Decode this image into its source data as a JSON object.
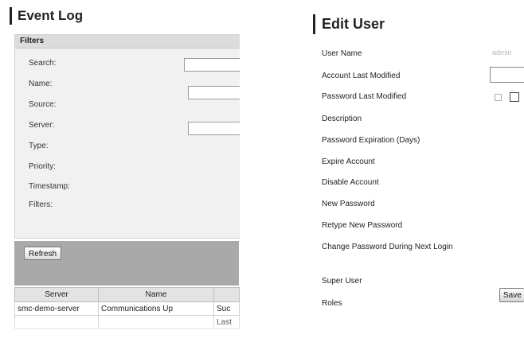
{
  "event_log": {
    "title": "Event Log",
    "filters_header": "Filters",
    "filters": [
      {
        "label": "Search:"
      },
      {
        "label": "Name:"
      },
      {
        "label": "Source:"
      },
      {
        "label": "Server:"
      },
      {
        "label": "Type:"
      },
      {
        "label": "Priority:"
      },
      {
        "label": "Timestamp:"
      },
      {
        "label": "Filters:"
      }
    ],
    "refresh_label": "Refresh",
    "table": {
      "columns": [
        "Server",
        "Name",
        ""
      ],
      "rows": [
        [
          "smc-demo-server",
          "Communications Up",
          "Suc"
        ],
        [
          "",
          "",
          "Last"
        ]
      ]
    }
  },
  "edit_user": {
    "title": "Edit User",
    "fields": {
      "user_name": "User Name",
      "account_last_modified": "Account Last Modified",
      "password_last_modified": "Password Last Modified",
      "description": "Description",
      "password_expiration": "Password Expiration (Days)",
      "expire_account": "Expire Account",
      "disable_account": "Disable Account",
      "new_password": "New Password",
      "retype_new_password": "Retype New Password",
      "change_password_next_login": "Change Password During Next Login",
      "super_user": "Super User",
      "roles": "Roles"
    },
    "user_name_value": "admin",
    "save_label": "Save"
  }
}
